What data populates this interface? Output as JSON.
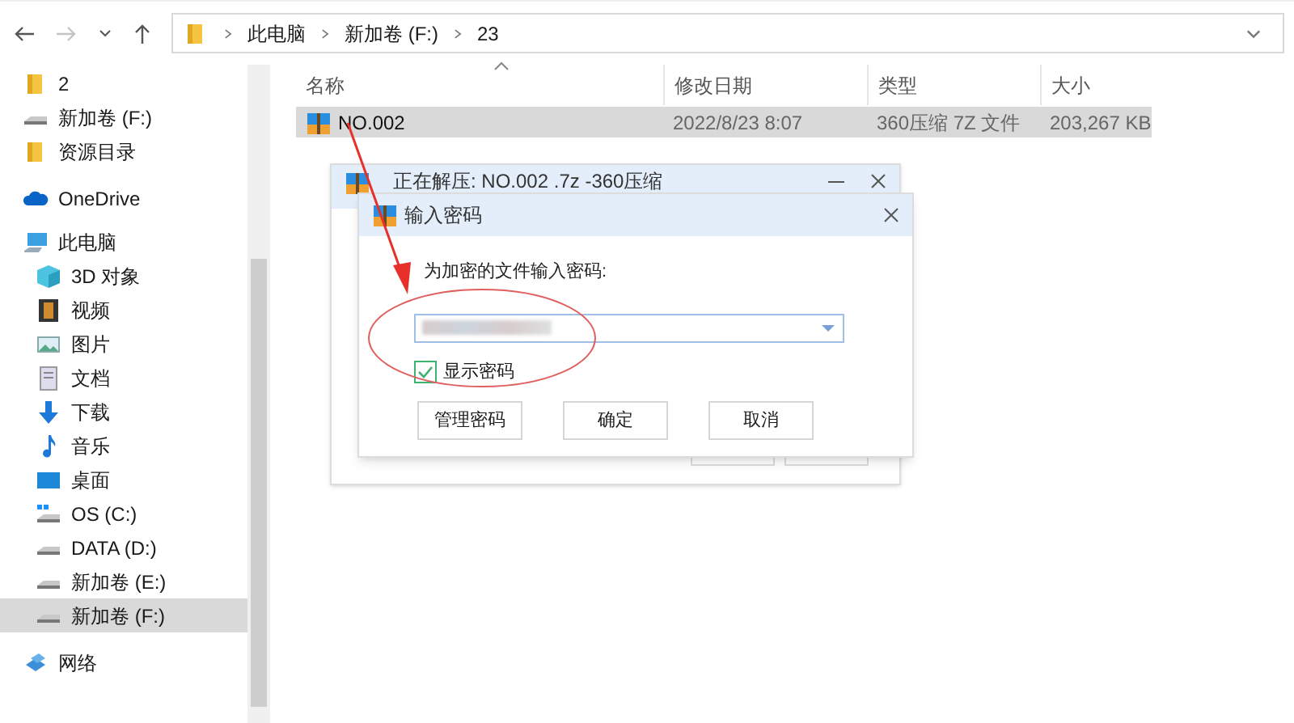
{
  "address_bar": {
    "crumbs": [
      "此电脑",
      "新加卷 (F:)",
      "23"
    ]
  },
  "nav_buttons": [
    {
      "kind": "back",
      "disabled": false
    },
    {
      "kind": "forward",
      "disabled": true
    },
    {
      "kind": "recent",
      "disabled": false
    },
    {
      "kind": "up",
      "disabled": false
    }
  ],
  "nav_pane": {
    "items": [
      {
        "label": "2",
        "kind": "folder",
        "selected": false
      },
      {
        "label": "新加卷 (F:)",
        "kind": "drive",
        "selected": false
      },
      {
        "label": "资源目录",
        "kind": "folder",
        "selected": false
      },
      {
        "label": "OneDrive",
        "kind": "cloud",
        "selected": false
      },
      {
        "label": "此电脑",
        "kind": "pc",
        "selected": false,
        "children": [
          {
            "label": "3D 对象",
            "kind": "cube",
            "selected": false
          },
          {
            "label": "视频",
            "kind": "video",
            "selected": false
          },
          {
            "label": "图片",
            "kind": "image",
            "selected": false
          },
          {
            "label": "文档",
            "kind": "doc",
            "selected": false
          },
          {
            "label": "下载",
            "kind": "download",
            "selected": false
          },
          {
            "label": "音乐",
            "kind": "music",
            "selected": false
          },
          {
            "label": "桌面",
            "kind": "desktop",
            "selected": false
          },
          {
            "label": "OS (C:)",
            "kind": "osdrive",
            "selected": false
          },
          {
            "label": "DATA (D:)",
            "kind": "drive",
            "selected": false
          },
          {
            "label": "新加卷 (E:)",
            "kind": "drive",
            "selected": false
          },
          {
            "label": "新加卷 (F:)",
            "kind": "drive",
            "selected": true
          }
        ]
      },
      {
        "label": "网络",
        "kind": "network",
        "selected": false
      }
    ]
  },
  "file_list": {
    "columns": [
      "名称",
      "修改日期",
      "类型",
      "大小"
    ],
    "rows": [
      {
        "cells": [
          "NO.002",
          "2022/8/23 8:07",
          "360压缩 7Z 文件",
          "203,267 KB"
        ],
        "selected": true
      }
    ]
  },
  "back_dialog": {
    "title": "正在解压: NO.002 .7z -360压缩"
  },
  "password_dialog": {
    "title": "输入密码",
    "prompt": "为加密的文件输入密码:",
    "show_password": {
      "label": "显示密码",
      "checked": true
    },
    "buttons": [
      "管理密码",
      "确定",
      "取消"
    ]
  }
}
